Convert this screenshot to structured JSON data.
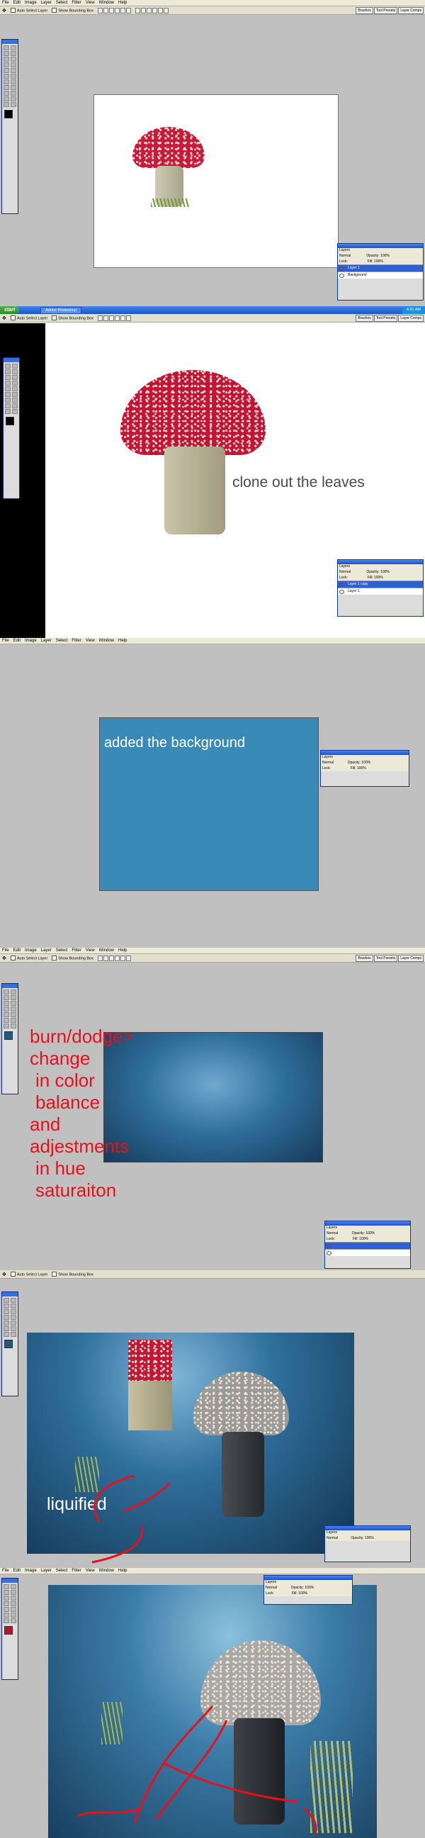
{
  "menu": [
    "File",
    "Edit",
    "Image",
    "Layer",
    "Select",
    "Filter",
    "View",
    "Window",
    "Help"
  ],
  "options": {
    "auto_select": "Auto Select Layer",
    "show_bounding": "Show Bounding Box"
  },
  "wells": [
    "Brushes",
    "Tool Presets",
    "Layer Comps"
  ],
  "layers_panel": {
    "title": "Layers",
    "blend": "Normal",
    "opacity_label": "Opacity:",
    "opacity_value": "100%",
    "fill_label": "Fill:",
    "fill_value": "100%",
    "lock_label": "Lock:"
  },
  "panel1": {
    "layers": [
      "Layer 1",
      "Background"
    ]
  },
  "panel2": {
    "layers": [
      "Layer 1 copy",
      "Layer 1"
    ],
    "annotation": "clone out the leaves",
    "taskbar": {
      "start": "start",
      "item": "Adobe Photoshop",
      "clock": "4:31 AM"
    }
  },
  "panel3": {
    "annotation": "added the background"
  },
  "panel4": {
    "annotation": [
      "burn/dodge>",
      "change",
      "in color",
      "balance",
      "and",
      "adjestments",
      "in hue",
      "saturaiton"
    ]
  },
  "panel5": {
    "annotation": "liquified"
  },
  "colors": {
    "annotation_red": "#e8101a",
    "water_blue": "#3a8ab8",
    "cap_red": "#c01838"
  }
}
